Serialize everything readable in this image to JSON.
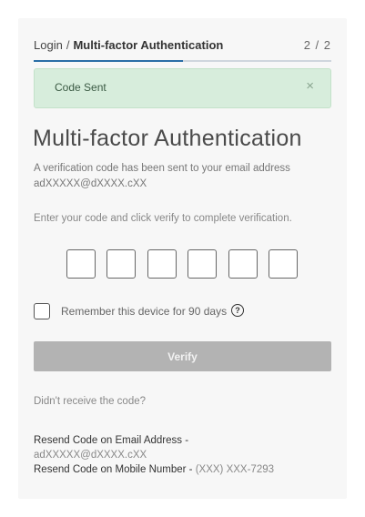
{
  "breadcrumb": {
    "login": "Login",
    "separator": "/",
    "current": "Multi-factor Authentication",
    "step": "2 / 2",
    "progress_fraction": 0.5
  },
  "alert": {
    "message": "Code Sent",
    "close_glyph": "×"
  },
  "main": {
    "title": "Multi-factor Authentication",
    "description": "A verification code has been sent to your email address",
    "masked_email": "adXXXXX@dXXXX.cXX",
    "instruction": "Enter your code and click verify to complete verification."
  },
  "code_inputs": [
    "",
    "",
    "",
    "",
    "",
    ""
  ],
  "remember": {
    "label": "Remember this device for 90 days",
    "checked": false,
    "help_glyph": "?"
  },
  "verify_button": {
    "label": "Verify"
  },
  "resend": {
    "prompt": "Didn't receive the code?",
    "email_label": "Resend Code on Email Address -",
    "email_value": "adXXXXX@dXXXX.cXX",
    "mobile_label": "Resend Code on Mobile Number -",
    "mobile_value": "(XXX) XXX-7293"
  },
  "colors": {
    "accent": "#2a6ea6",
    "alert_bg": "#d7eddc",
    "disabled_button": "#b3b3b3"
  }
}
